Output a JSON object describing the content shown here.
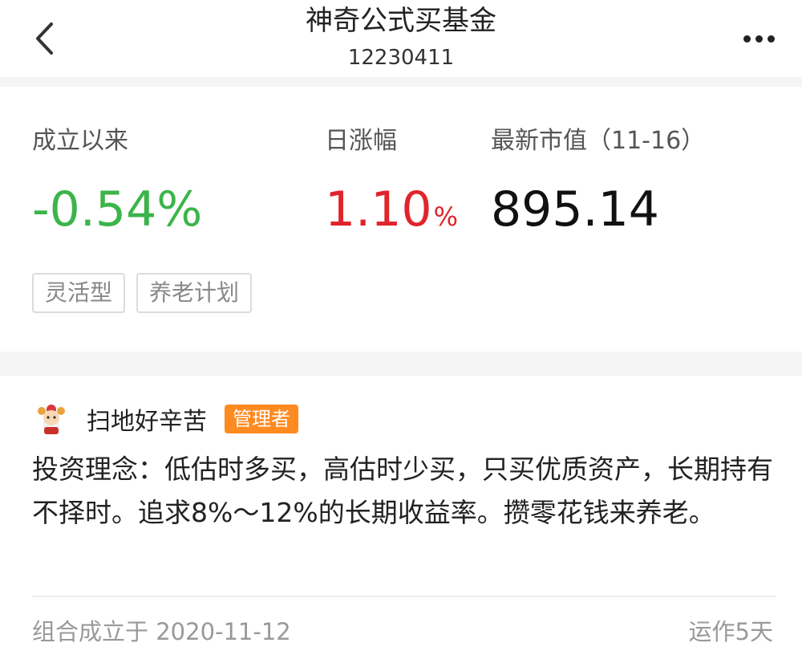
{
  "header": {
    "title": "神奇公式买基金",
    "subtitle": "12230411",
    "back_icon": "chevron-left-icon",
    "more_icon": "more-horizontal-icon"
  },
  "stats": {
    "since_inception": {
      "label": "成立以来",
      "value": "-0.54%",
      "color": "#3cb44a"
    },
    "daily_change": {
      "label": "日涨幅",
      "value": "1.10",
      "unit": "%",
      "color": "#e0242b"
    },
    "latest_value": {
      "label": "最新市值（11-16）",
      "value": "895.14"
    }
  },
  "tags": [
    "灵活型",
    "养老计划"
  ],
  "manager": {
    "avatar_icon": "avatar-icon",
    "name": "扫地好辛苦",
    "role": "管理者",
    "role_color": "#ff8a1f"
  },
  "description": "投资理念：低估时多买，高估时少买，只买优质资产，长期持有不择时。追求8%～12%的长期收益率。攒零花钱来养老。",
  "footer": {
    "established": "组合成立于 2020-11-12",
    "running": "运作5天"
  }
}
